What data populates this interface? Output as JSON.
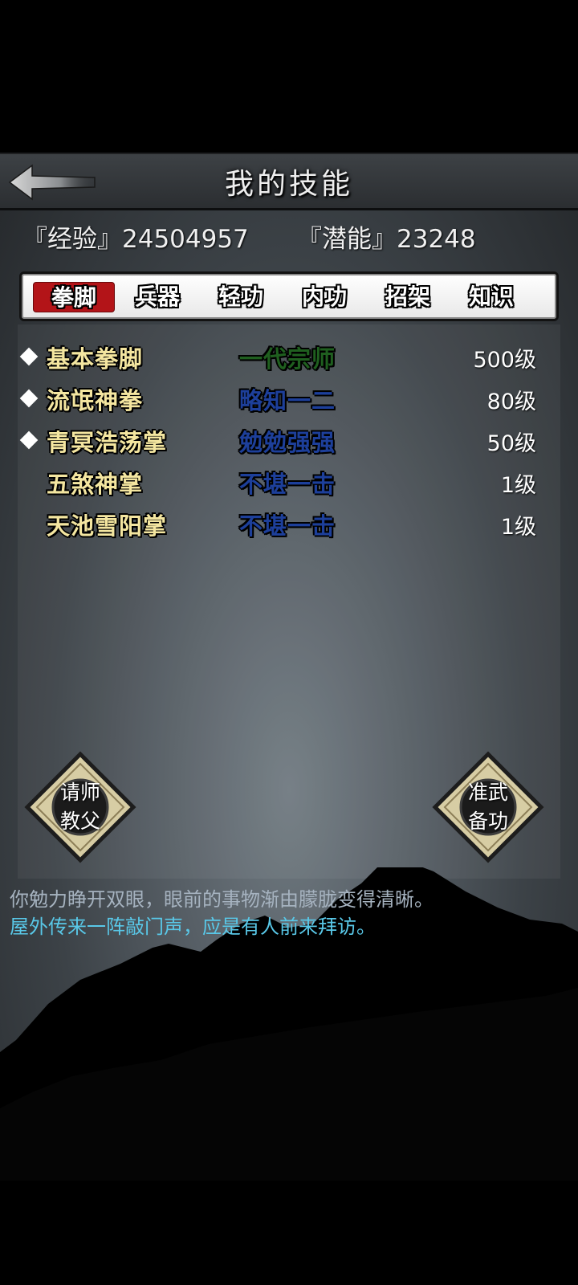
{
  "header": {
    "title": "我的技能"
  },
  "stats": {
    "exp": "『经验』24504957",
    "potential": "『潜能』23248"
  },
  "tabs": [
    {
      "label": "拳脚",
      "active": true
    },
    {
      "label": "兵器",
      "active": false
    },
    {
      "label": "轻功",
      "active": false
    },
    {
      "label": "内功",
      "active": false
    },
    {
      "label": "招架",
      "active": false
    },
    {
      "label": "知识",
      "active": false
    }
  ],
  "skills": [
    {
      "name": "基本拳脚",
      "rank": "一代宗师",
      "rank_color": "#1f5f1f",
      "level": "500级",
      "marked": true
    },
    {
      "name": "流氓神拳",
      "rank": "略知一二",
      "rank_color": "#1d3f9a",
      "level": "80级",
      "marked": true
    },
    {
      "name": "青冥浩荡掌",
      "rank": "勉勉强强",
      "rank_color": "#1d3f9a",
      "level": "50级",
      "marked": true
    },
    {
      "name": "五煞神掌",
      "rank": "不堪一击",
      "rank_color": "#1d3f9a",
      "level": "1级",
      "marked": false
    },
    {
      "name": "天池雪阳掌",
      "rank": "不堪一击",
      "rank_color": "#1d3f9a",
      "level": "1级",
      "marked": false
    }
  ],
  "buttons": {
    "left_line1": "请师",
    "left_line2": "教父",
    "right_line1": "准武",
    "right_line2": "备功"
  },
  "messages": {
    "line1": "你勉力睁开双眼，眼前的事物渐由朦胧变得清晰。",
    "line2": "屋外传来一阵敲门声，应是有人前来拜访。",
    "line1_color": "#a6b3c0",
    "line2_color": "#59c8e8"
  },
  "icons": {
    "back": "back-arrow-icon"
  }
}
